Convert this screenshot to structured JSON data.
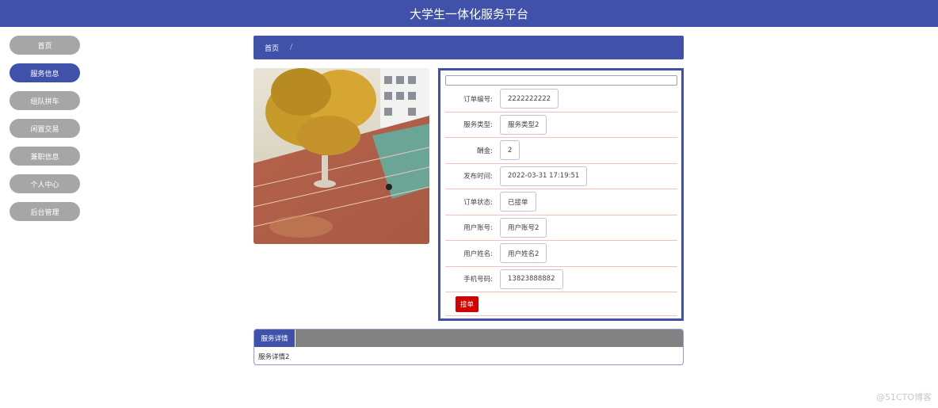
{
  "header": {
    "title": "大学生一体化服务平台"
  },
  "sidebar": {
    "items": [
      {
        "label": "首页"
      },
      {
        "label": "服务信息"
      },
      {
        "label": "组队拼车"
      },
      {
        "label": "闲置交易"
      },
      {
        "label": "兼职信息"
      },
      {
        "label": "个人中心"
      },
      {
        "label": "后台管理"
      }
    ],
    "active_index": 1
  },
  "breadcrumb": {
    "home": "首页",
    "separator": "/"
  },
  "detail": {
    "fields": [
      {
        "label": "订单编号:",
        "value": "2222222222"
      },
      {
        "label": "服务类型:",
        "value": "服务类型2"
      },
      {
        "label": "酬金:",
        "value": "2"
      },
      {
        "label": "发布时间:",
        "value": "2022-03-31 17:19:51"
      },
      {
        "label": "订单状态:",
        "value": "已接单"
      },
      {
        "label": "用户账号:",
        "value": "用户账号2"
      },
      {
        "label": "用户姓名:",
        "value": "用户姓名2"
      },
      {
        "label": "手机号码:",
        "value": "13823888882"
      }
    ],
    "accept_label": "接单"
  },
  "tabs": {
    "active_label": "服务详情",
    "content": "服务详情2"
  },
  "watermark": "@51CTO博客",
  "colors": {
    "primary": "#3f51a9",
    "nav_inactive": "#a6a6a6",
    "danger": "#d00000",
    "tab_bar": "#828282"
  }
}
